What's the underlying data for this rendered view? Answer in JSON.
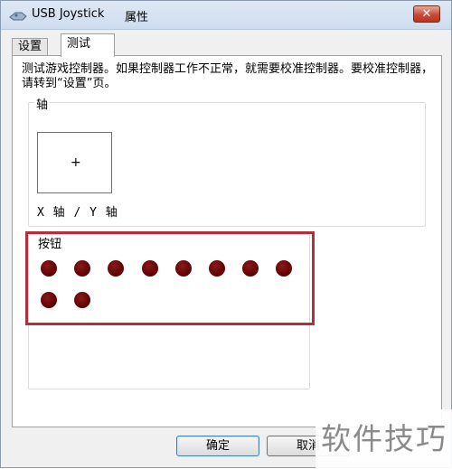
{
  "window": {
    "title": "USB Joystick",
    "title_suffix": "属性",
    "close_glyph": "✕"
  },
  "tabs": [
    {
      "label": "设置",
      "active": false
    },
    {
      "label": "测试",
      "active": true
    }
  ],
  "test_panel": {
    "description": "测试游戏控制器。如果控制器工作不正常，就需要校准控制器。要校准控制器，请转到“设置”页。",
    "axis_group_label": "轴",
    "crosshair": "+",
    "axis_caption": "X 轴 / Y 轴",
    "buttons_group_label": "按钮",
    "buttons_count": 10,
    "led_color": "#5b0000",
    "highlight_color": "#b0303c"
  },
  "footer": {
    "ok_label": "确定",
    "cancel_label": "取消"
  },
  "watermark": {
    "text": "软件技巧"
  }
}
